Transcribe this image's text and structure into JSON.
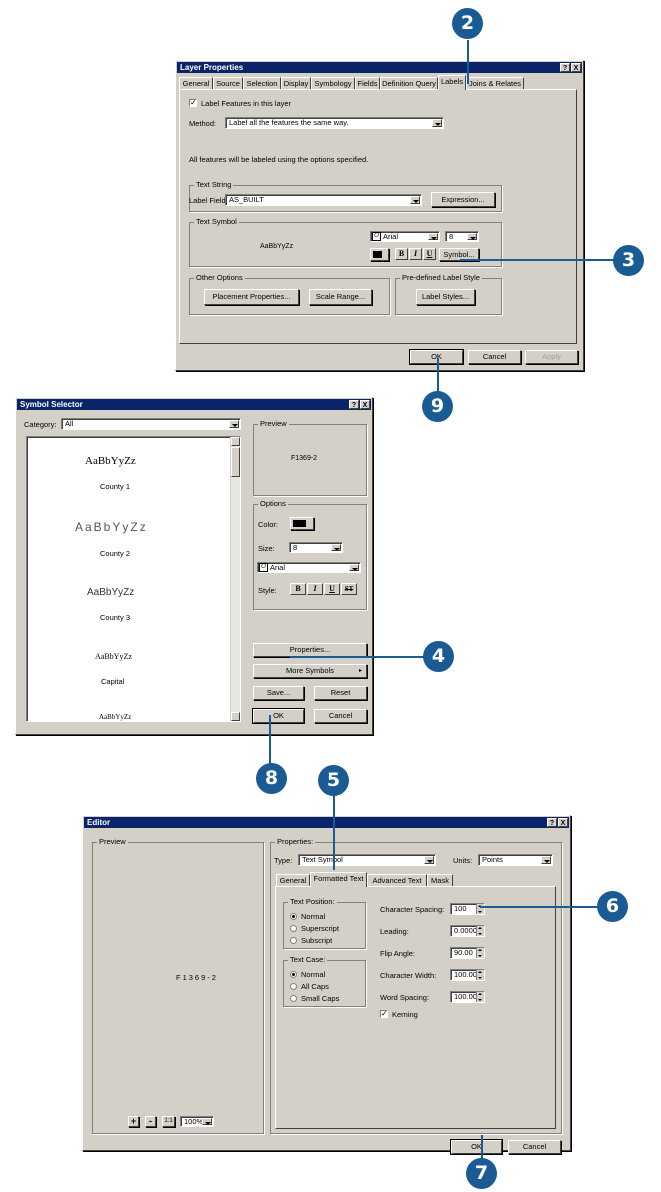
{
  "layer_props": {
    "title": "Layer Properties",
    "help": "?",
    "close": "X",
    "tabs": [
      "General",
      "Source",
      "Selection",
      "Display",
      "Symbology",
      "Fields",
      "Definition Query",
      "Labels",
      "Joins & Relates"
    ],
    "active_tab": "Labels",
    "label_features": "Label Features in this layer",
    "method_label": "Method:",
    "method_value": "Label all the features the same way.",
    "info": "All features will be labeled using the options specified.",
    "text_string_group": "Text String",
    "label_field_label": "Label Field:",
    "label_field_value": "AS_BUILT",
    "expression_btn": "Expression...",
    "text_symbol_group": "Text Symbol",
    "preview_text": "AaBbYyZz",
    "font_value": "Arial",
    "size_value": "8",
    "bold": "B",
    "italic": "I",
    "underline": "U",
    "symbol_btn": "Symbol...",
    "other_options_group": "Other Options",
    "placement_btn": "Placement Properties...",
    "scale_btn": "Scale Range...",
    "predefined_group": "Pre-defined Label Style",
    "label_styles_btn": "Label Styles...",
    "ok": "OK",
    "cancel": "Cancel",
    "apply": "Apply"
  },
  "symbol_selector": {
    "title": "Symbol Selector",
    "help": "?",
    "close": "X",
    "category_label": "Category:",
    "category_value": "All",
    "items": [
      {
        "sample": "AaBbYyZz",
        "name": "County 1"
      },
      {
        "sample": "AaBbYyZz",
        "name": "County 2"
      },
      {
        "sample": "AaBbYyZz",
        "name": "County 3"
      },
      {
        "sample": "AaBbYyZz",
        "name": "Capital"
      },
      {
        "sample": "AaBbYyZz",
        "name": ""
      }
    ],
    "preview_group": "Preview",
    "preview_text": "F1369-2",
    "options_group": "Options",
    "color_label": "Color:",
    "size_label": "Size:",
    "size_value": "8",
    "font_value": "Arial",
    "style_label": "Style:",
    "style_b": "B",
    "style_i": "I",
    "style_u": "U",
    "style_s": "ST",
    "properties_btn": "Properties...",
    "more_symbols_btn": "More Symbols",
    "save_btn": "Save...",
    "reset_btn": "Reset",
    "ok": "OK",
    "cancel": "Cancel"
  },
  "editor": {
    "title": "Editor",
    "help": "?",
    "close": "X",
    "preview_group": "Preview",
    "preview_text": "F1369-2",
    "zoom_value": "100%",
    "zoom_in": "+",
    "zoom_out": "-",
    "fit": "1:1",
    "properties_group": "Properties:",
    "type_label": "Type:",
    "type_value": "Text Symbol",
    "units_label": "Units:",
    "units_value": "Points",
    "tabs": [
      "General",
      "Formatted Text",
      "Advanced Text",
      "Mask"
    ],
    "active_tab": "Formatted Text",
    "text_position_group": "Text Position:",
    "pos_normal": "Normal",
    "pos_superscript": "Superscript",
    "pos_subscript": "Subscript",
    "text_case_group": "Text Case:",
    "case_normal": "Normal",
    "case_allcaps": "All Caps",
    "case_smallcaps": "Small Caps",
    "char_spacing_label": "Character Spacing:",
    "char_spacing_value": "100",
    "leading_label": "Leading:",
    "leading_value": "0.0000",
    "flip_label": "Flip Angle:",
    "flip_value": "90.00",
    "char_width_label": "Character Width:",
    "char_width_value": "100.00",
    "word_spacing_label": "Word Spacing:",
    "word_spacing_value": "100.00",
    "kerning_label": "Kerning",
    "ok": "OK",
    "cancel": "Cancel"
  },
  "callouts": [
    "2",
    "3",
    "9",
    "4",
    "8",
    "5",
    "6",
    "7"
  ],
  "colors": {
    "callout": "#1a5b94",
    "titlebar": "#0a246a",
    "dialog": "#d4d0c8"
  }
}
